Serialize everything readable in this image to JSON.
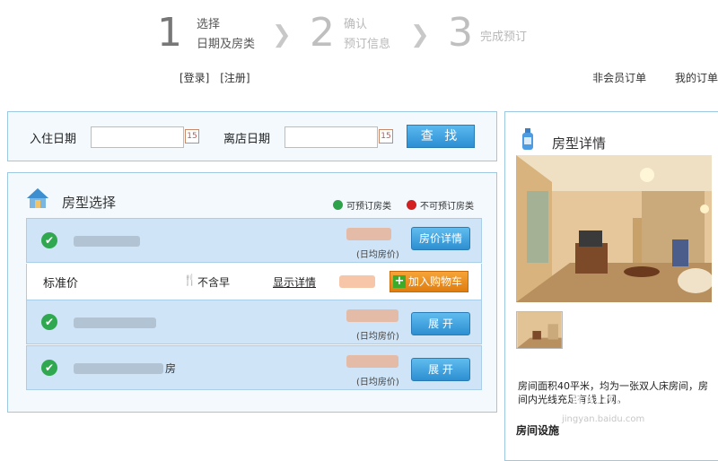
{
  "steps": [
    {
      "num": "1",
      "line1": "选择",
      "line2": "日期及房类"
    },
    {
      "num": "2",
      "line1": "确认",
      "line2": "预订信息"
    },
    {
      "num": "3",
      "line1": "完成预订",
      "line2": ""
    }
  ],
  "auth": {
    "login": "[登录]",
    "register": "[注册]"
  },
  "top_links": {
    "non_member_orders": "非会员订单",
    "my_orders": "我的订单"
  },
  "search": {
    "checkin_label": "入住日期",
    "checkout_label": "离店日期",
    "search_button": "查 找"
  },
  "room_select": {
    "title": "房型选择",
    "legend_available": "可预订房类",
    "legend_unavailable": "不可预订房类",
    "avg_price_label": "(日均房价)",
    "rows": [
      {
        "button": "房价详情",
        "name_suffix": ""
      },
      {
        "button": "展 开",
        "name_suffix": ""
      },
      {
        "button": "展 开",
        "name_suffix": "房"
      }
    ],
    "standard_rate": {
      "label": "标准价",
      "breakfast": "不含早",
      "show_details": "显示详情",
      "add_to_cart": "加入购物车"
    }
  },
  "room_detail": {
    "title": "房型详情",
    "description": "房间面积40平米，均为一张双人床房间，房间内光线充足有线上网。",
    "facility_label": "房间设施"
  },
  "watermark": {
    "main": "Baidu经验",
    "sub": "jingyan.baidu.com"
  },
  "colors": {
    "accent_blue": "#2b8fd3",
    "available_green": "#2ea24a",
    "unavailable_red": "#d32020",
    "cart_orange": "#e07d10"
  }
}
